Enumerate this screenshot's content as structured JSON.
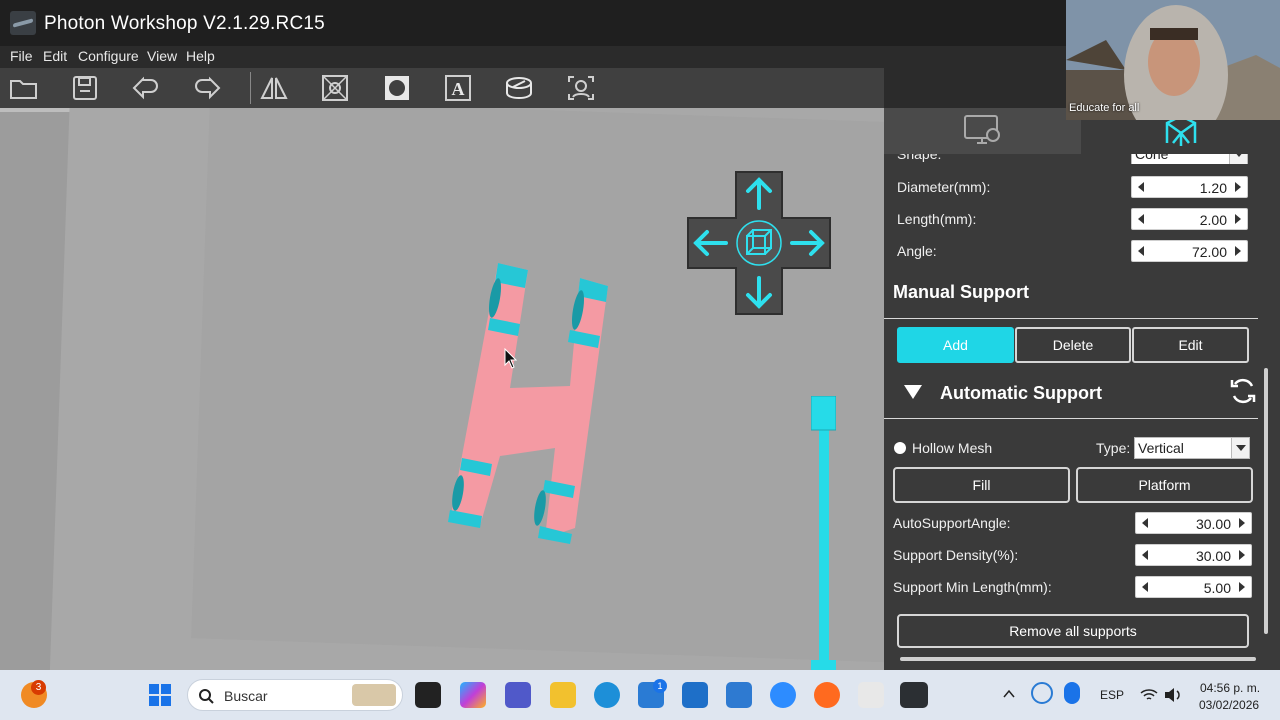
{
  "window": {
    "title": "Photon Workshop V2.1.29.RC15"
  },
  "menu": [
    "File",
    "Edit",
    "Configure",
    "View",
    "Help"
  ],
  "toolbar": {
    "icons": [
      "open-folder-icon",
      "save-icon",
      "undo-icon",
      "redo-icon",
      "mirror-icon",
      "hollow-icon",
      "punch-hole-icon",
      "text-icon",
      "slice-icon",
      "face-icon"
    ]
  },
  "support_settings": {
    "shape": {
      "label": "Shape:",
      "value": "Cone"
    },
    "diameter": {
      "label": "Diameter(mm):",
      "value": "1.20"
    },
    "length": {
      "label": "Length(mm):",
      "value": "2.00"
    },
    "angle": {
      "label": "Angle:",
      "value": "72.00"
    }
  },
  "manual_support": {
    "title": "Manual Support",
    "add": "Add",
    "delete": "Delete",
    "edit": "Edit"
  },
  "automatic_support": {
    "title": "Automatic Support",
    "hollow_mesh": "Hollow Mesh",
    "type_label": "Type:",
    "type_value": "Vertical",
    "fill": "Fill",
    "platform": "Platform",
    "auto_angle": {
      "label": "AutoSupportAngle:",
      "value": "30.00"
    },
    "density": {
      "label": "Support Density(%):",
      "value": "30.00"
    },
    "min_length": {
      "label": "Support Min Length(mm):",
      "value": "5.00"
    },
    "remove_all": "Remove all supports"
  },
  "webcam": {
    "label": "Educate for all"
  },
  "taskbar": {
    "search_placeholder": "Buscar",
    "notification_count": "3",
    "store_badge": "1",
    "language": "ESP",
    "time": "04:56 p. m.",
    "date": "03/02/2026"
  },
  "colors": {
    "accent": "#1fd6e6",
    "model": "#f49aa3",
    "panel": "#3a3a3a"
  }
}
